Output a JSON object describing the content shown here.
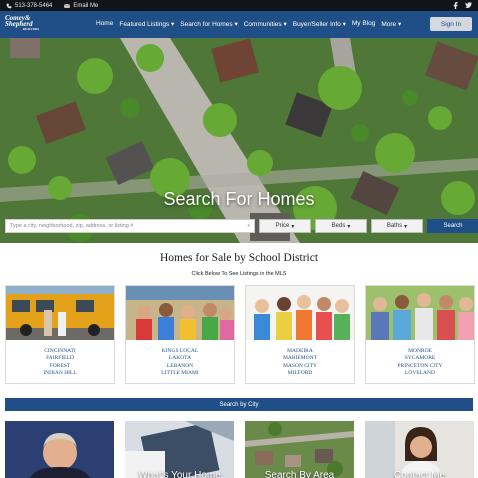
{
  "topbar": {
    "phone": "513-378-5464",
    "email": "Email Me",
    "social": [
      "facebook-icon",
      "twitter-icon"
    ]
  },
  "nav": {
    "logo_line1": "Comey&",
    "logo_line2": "Shepherd",
    "logo_tag": "REALTORS",
    "items": [
      {
        "label": "Home"
      },
      {
        "label": "Featured Listings ▾"
      },
      {
        "label": "Search for Homes ▾"
      },
      {
        "label": "Communities ▾"
      },
      {
        "label": "Buyer/Seller Info ▾"
      },
      {
        "label": "My Blog"
      },
      {
        "label": "More ▾"
      }
    ],
    "signin": "Sign In"
  },
  "hero": {
    "title": "Search For Homes",
    "search_placeholder": "Type a city, neighborhood, zip, address, or listing #",
    "price": "Price",
    "beds": "Beds",
    "baths": "Baths",
    "search_button": "Search"
  },
  "schools": {
    "title": "Homes for Sale by School District",
    "subtitle": "Click Below To See Listings in the MLS",
    "cards": [
      {
        "names": [
          "CINCINNATI",
          "FAIRFIELD",
          "FOREST",
          "INDIAN HILL"
        ]
      },
      {
        "names": [
          "KINGS LOCAL",
          "LAKOTA",
          "LEBANON",
          "LITTLE MIAMI"
        ]
      },
      {
        "names": [
          "MADEIRA",
          "MARIEMONT",
          "MASON CITY",
          "MILFORD"
        ]
      },
      {
        "names": [
          "MONROE",
          "SYCAMORE",
          "PRINCETON CITY",
          "LOVELAND"
        ]
      }
    ],
    "city_button": "Search by City"
  },
  "tiles": [
    {
      "label": ""
    },
    {
      "label": "What's Your Home"
    },
    {
      "label": "Search By Area"
    },
    {
      "label": "Contact Me"
    }
  ],
  "colors": {
    "brand_blue": "#1f4f86",
    "topbar": "#111418"
  }
}
